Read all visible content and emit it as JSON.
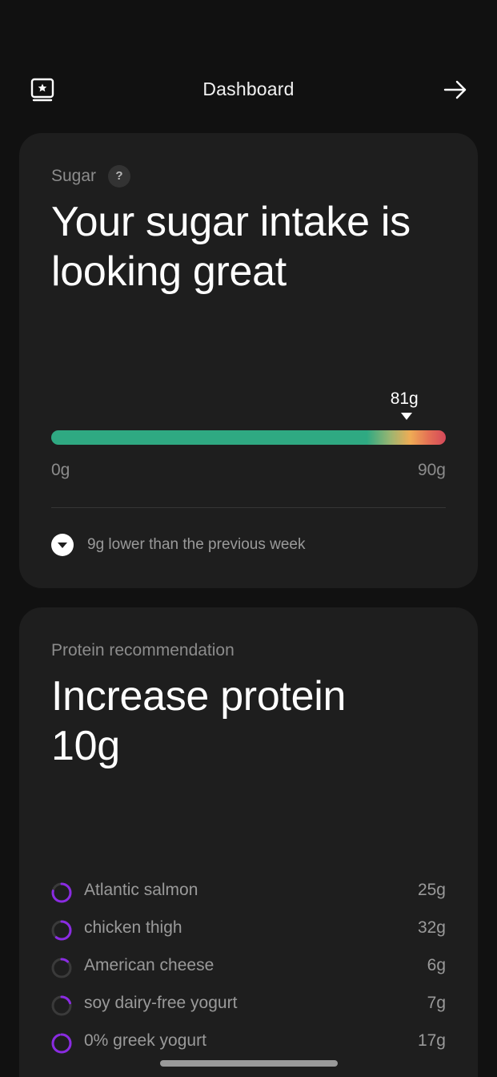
{
  "header": {
    "title": "Dashboard",
    "left_icon": "star-badge-icon",
    "right_icon": "arrow-right-icon"
  },
  "sugar_card": {
    "eyebrow": "Sugar",
    "help_label": "?",
    "headline": "Your sugar intake is looking great",
    "marker_label": "81g",
    "value": 81,
    "max": 90,
    "min_label": "0g",
    "max_label": "90g",
    "change_icon": "chevron-down-circle-icon",
    "change_text": "9g lower than the previous week"
  },
  "protein_card": {
    "eyebrow": "Protein recommendation",
    "headline": "Increase protein 10g",
    "foods": [
      {
        "name": "Atlantic salmon",
        "qty": "25g",
        "progress": 0.78
      },
      {
        "name": "chicken thigh",
        "qty": "32g",
        "progress": 0.6
      },
      {
        "name": "American cheese",
        "qty": "6g",
        "progress": 0.12
      },
      {
        "name": "soy dairy-free yogurt",
        "qty": "7g",
        "progress": 0.2
      },
      {
        "name": "0% greek yogurt",
        "qty": "17g",
        "progress": 0.95
      }
    ]
  },
  "colors": {
    "background": "#111111",
    "card": "#1e1e1e",
    "good": "#2fa982",
    "warn": "#efac55",
    "bad": "#d4485a",
    "ring_accent": "#8a2be2"
  }
}
